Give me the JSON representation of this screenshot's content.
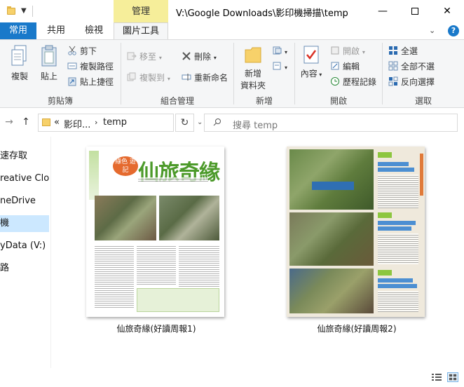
{
  "window": {
    "path": "V:\\Google Downloads\\影印機掃描\\temp",
    "context_tab": "管理",
    "minimize_glyph": "—",
    "close_glyph": "✕"
  },
  "ribbon_tabs": {
    "file": "常用",
    "share": "共用",
    "view": "檢視",
    "picture_tools": "圖片工具"
  },
  "ribbon": {
    "clipboard": {
      "label": "剪貼簿",
      "copy": "複製",
      "paste": "貼上",
      "cut": "剪下",
      "copy_path": "複製路徑",
      "paste_shortcut": "貼上捷徑"
    },
    "organize": {
      "label": "組合管理",
      "move_to": "移至",
      "copy_to": "複製到",
      "delete": "刪除",
      "rename": "重新命名"
    },
    "new": {
      "label": "新增",
      "new_folder_line1": "新增",
      "new_folder_line2": "資料夾"
    },
    "open": {
      "label": "開啟",
      "properties": "內容",
      "open": "開啟",
      "edit": "編輯",
      "history": "歷程記錄"
    },
    "select": {
      "label": "選取",
      "select_all": "全選",
      "select_none": "全部不選",
      "invert": "反向選擇"
    }
  },
  "address": {
    "overflow": "«",
    "segment1": "影印...",
    "segment2": "temp",
    "search_placeholder": "搜尋 temp"
  },
  "nav": {
    "items": [
      {
        "label": "速存取"
      },
      {
        "label": "reative Clouc"
      },
      {
        "label": "neDrive"
      },
      {
        "label": "機"
      },
      {
        "label": "yData (V:)"
      },
      {
        "label": "路"
      }
    ]
  },
  "files": [
    {
      "name": "仙旅奇緣(好讀周報1)",
      "thumb_title": "仙旅奇緣",
      "thumb_badge": "綠色 遊記"
    },
    {
      "name": "仙旅奇緣(好讀周報2)"
    }
  ],
  "colors": {
    "accent": "#1979ca",
    "manage_tab": "#f6ee9a",
    "selection": "#cce8ff"
  }
}
